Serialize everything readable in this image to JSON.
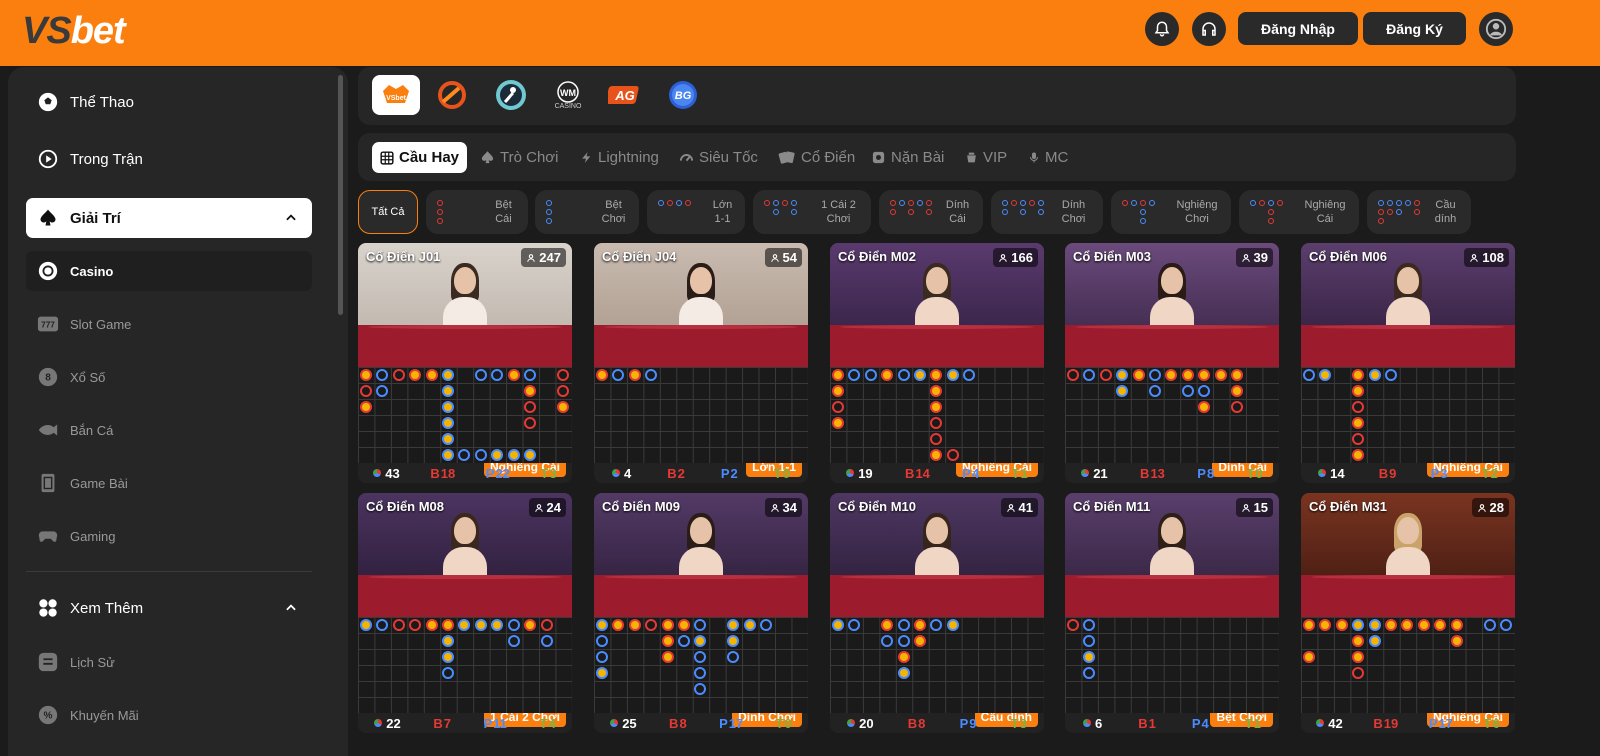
{
  "header": {
    "logo_prefix": "VS",
    "logo_suffix": "bet",
    "login_label": "Đăng Nhập",
    "register_label": "Đăng Ký"
  },
  "sidebar": {
    "items": [
      {
        "label": "Thể Thao"
      },
      {
        "label": "Trong Trận"
      },
      {
        "label": "Giải Trí"
      },
      {
        "label": "Casino"
      },
      {
        "label": "Slot Game"
      },
      {
        "label": "Xổ Số"
      },
      {
        "label": "Bắn Cá"
      },
      {
        "label": "Game Bài"
      },
      {
        "label": "Gaming"
      },
      {
        "label": "Xem Thêm"
      },
      {
        "label": "Lịch Sử"
      },
      {
        "label": "Khuyến Mãi"
      }
    ]
  },
  "providers": {
    "items": [
      {
        "name": "VSbet"
      },
      {
        "name": "D"
      },
      {
        "name": "E"
      },
      {
        "name": "WM",
        "caption": "CASINO"
      },
      {
        "name": "AG"
      },
      {
        "name": "BG"
      }
    ]
  },
  "tabs": [
    {
      "label": "Cầu Hay"
    },
    {
      "label": "Trò Chơi"
    },
    {
      "label": "Lightning"
    },
    {
      "label": "Siêu Tốc"
    },
    {
      "label": "Cổ Điển"
    },
    {
      "label": "Nặn Bài"
    },
    {
      "label": "VIP"
    },
    {
      "label": "MC"
    }
  ],
  "filters": [
    {
      "label": "Tất Cả"
    },
    {
      "label": "Bệt Cái"
    },
    {
      "label": "Bệt Chơi"
    },
    {
      "label": "Lớn 1-1"
    },
    {
      "label": "1 Cái 2 Chơi"
    },
    {
      "label": "Dính Cái"
    },
    {
      "label": "Dính Chơi"
    },
    {
      "label": "Nghiêng Chơi"
    },
    {
      "label": "Nghiêng Cái"
    },
    {
      "label": "Cầu dính"
    }
  ],
  "games": [
    {
      "title": "Cổ Điển J01",
      "players": "247",
      "tag": "Nghiêng Cái",
      "total": "43",
      "b": "18",
      "p": "22",
      "t": "3"
    },
    {
      "title": "Cổ Điển J04",
      "players": "54",
      "tag": "Lớn 1-1",
      "total": "4",
      "b": "2",
      "p": "2",
      "t": "0"
    },
    {
      "title": "Cổ Điển M02",
      "players": "166",
      "tag": "Nghiêng Cái",
      "total": "19",
      "b": "14",
      "p": "4",
      "t": "1"
    },
    {
      "title": "Cổ Điển M03",
      "players": "39",
      "tag": "Dính Cái",
      "total": "21",
      "b": "13",
      "p": "8",
      "t": "0"
    },
    {
      "title": "Cổ Điển M06",
      "players": "108",
      "tag": "Nghiêng Cái",
      "total": "14",
      "b": "9",
      "p": "3",
      "t": "2"
    },
    {
      "title": "Cổ Điển M08",
      "players": "24",
      "tag": "1 Cái 2 Chơi",
      "total": "22",
      "b": "7",
      "p": "11",
      "t": "4"
    },
    {
      "title": "Cổ Điển M09",
      "players": "34",
      "tag": "Dính Chơi",
      "total": "25",
      "b": "8",
      "p": "17",
      "t": "0"
    },
    {
      "title": "Cổ Điển M10",
      "players": "41",
      "tag": "Cầu dính",
      "total": "20",
      "b": "8",
      "p": "9",
      "t": "3"
    },
    {
      "title": "Cổ Điển M11",
      "players": "15",
      "tag": "Bệt Chơi",
      "total": "6",
      "b": "1",
      "p": "4",
      "t": "1"
    },
    {
      "title": "Cổ Điển M31",
      "players": "28",
      "tag": "Nghiêng Cái",
      "total": "42",
      "b": "19",
      "p": "17",
      "t": "6"
    }
  ],
  "stat_keys": {
    "b": "B",
    "p": "P",
    "t": "T"
  },
  "colors": {
    "accent": "#fb7f0e",
    "banker": "#e53935",
    "player": "#4a8cff",
    "tie": "#7cb342"
  },
  "icons": [
    "bell-icon",
    "headset-icon",
    "user-icon",
    "soccer-ball-icon",
    "live-icon",
    "spade-icon",
    "chevron-up-icon",
    "casino-chip-icon",
    "slot-777-icon",
    "lottery-8-icon",
    "fish-icon",
    "cards-icon",
    "gamepad-icon",
    "more-icon",
    "history-icon",
    "promo-icon",
    "grid-icon",
    "users-icon"
  ]
}
